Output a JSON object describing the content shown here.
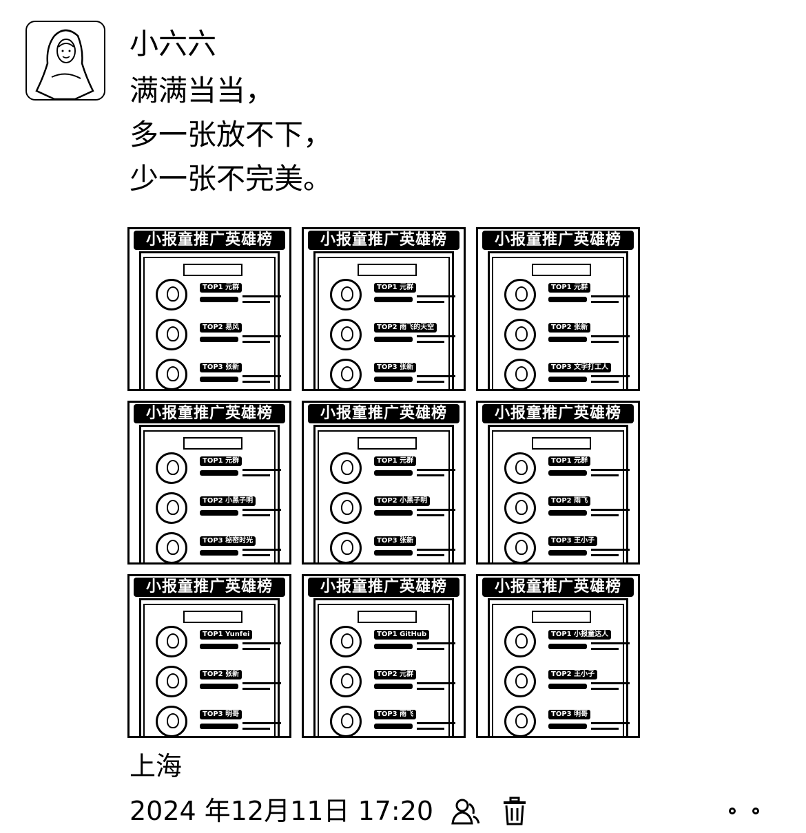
{
  "post": {
    "author": "小六六",
    "lines": [
      "满满当当，",
      "多一张放不下，",
      "少一张不完美。"
    ],
    "location": "上海",
    "timestamp": "2024 年12月11日 17:20"
  },
  "tile_title": "小报童推广英雄榜",
  "images": [
    {
      "ranks": [
        "TOP1 元群",
        "TOP2 易风",
        "TOP3 张新"
      ]
    },
    {
      "ranks": [
        "TOP1 元群",
        "TOP2 雨飞的天空",
        "TOP3 张新"
      ]
    },
    {
      "ranks": [
        "TOP1 元群",
        "TOP2 张新",
        "TOP3 文字打工人"
      ]
    },
    {
      "ranks": [
        "TOP1 元群",
        "TOP2 小黑子明",
        "TOP3 秘密时光"
      ]
    },
    {
      "ranks": [
        "TOP1 元群",
        "TOP2 小黑子明",
        "TOP3 张新"
      ]
    },
    {
      "ranks": [
        "TOP1 元群",
        "TOP2 雨飞",
        "TOP3 王小子"
      ]
    },
    {
      "ranks": [
        "TOP1 Yunfei",
        "TOP2 张新",
        "TOP3 明哥"
      ]
    },
    {
      "ranks": [
        "TOP1 GitHub",
        "TOP2 元群",
        "TOP3 雨飞"
      ]
    },
    {
      "ranks": [
        "TOP1 小报童达人",
        "TOP2 王小子",
        "TOP3 明哥"
      ]
    }
  ],
  "icons": {
    "like": "like-icon",
    "delete": "trash-icon",
    "more": "more-icon"
  }
}
